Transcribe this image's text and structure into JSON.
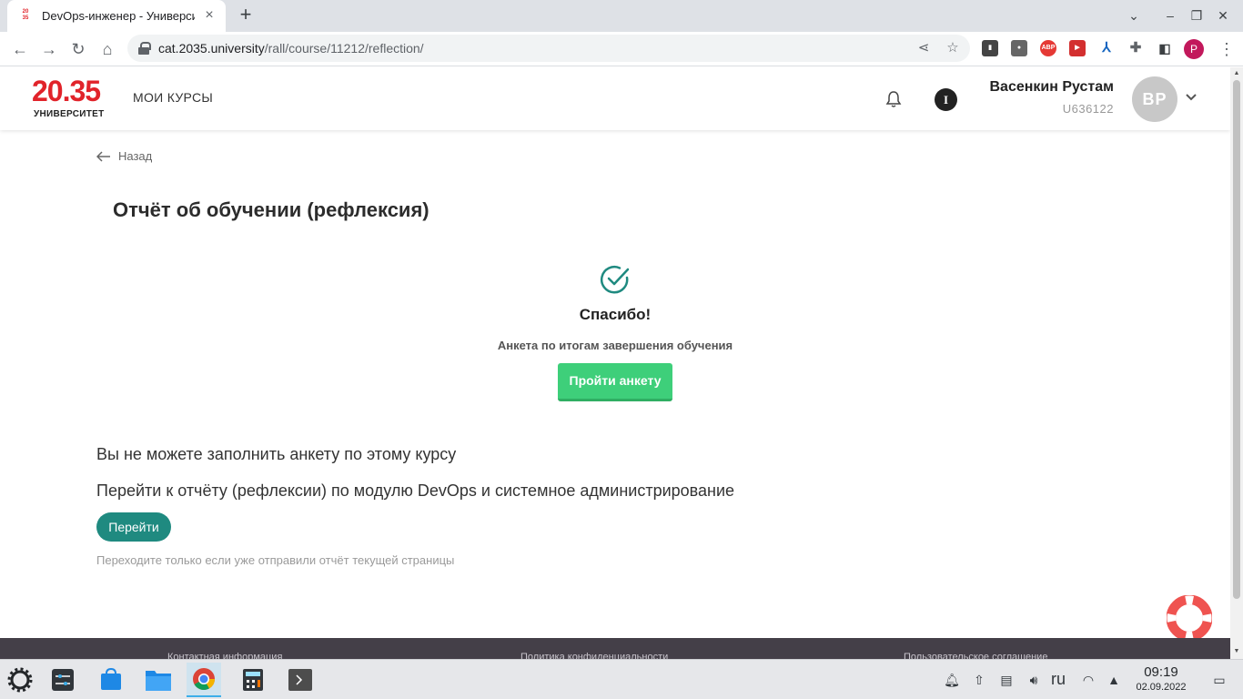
{
  "browser": {
    "tab_title": "DevOps-инженер - Универси",
    "url_host": "cat.2035.university",
    "url_path": "/rall/course/11212/reflection/",
    "profile_letter": "P",
    "favicon_text": "20 35",
    "extensions": [
      "bitwarden-icon",
      "account-icon",
      "adblock-icon",
      "video-icon",
      "translate-icon",
      "puzzle-icon",
      "sidebar-icon"
    ]
  },
  "header": {
    "logo_number": "20.35",
    "logo_subtitle": "УНИВЕРСИТЕТ",
    "nav_my_courses": "МОИ КУРСЫ",
    "info_label": "I",
    "user_name": "Васенкин Рустам",
    "user_id": "U636122",
    "avatar_initials": "ВР"
  },
  "page": {
    "back_label": "Назад",
    "title": "Отчёт об обучении (рефлексия)",
    "thanks": "Спасибо!",
    "survey_caption": "Анкета по итогам завершения обучения",
    "survey_button": "Пройти анкету",
    "cannot_fill": "Вы не можете заполнить анкету по этому курсу",
    "goto_module": "Перейти к отчёту (рефлексии) по модулю DevOps и системное администрирование",
    "goto_button": "Перейти",
    "hint": "Переходите только если уже отправили отчёт текущей страницы"
  },
  "footer": {
    "contact": "Контактная информация",
    "privacy": "Политика конфиденциальности",
    "agreement": "Пользовательское соглашение"
  },
  "taskbar": {
    "apps": [
      "settings-icon",
      "store-icon",
      "files-icon",
      "chrome-icon",
      "calculator-icon",
      "terminal-icon"
    ],
    "language": "ru",
    "time": "09:19",
    "date": "02.09.2022"
  },
  "colors": {
    "brand_red": "#e1232a",
    "accent_teal": "#1f8a80",
    "survey_green": "#3ecf7a",
    "footer_bg": "#443f48"
  }
}
